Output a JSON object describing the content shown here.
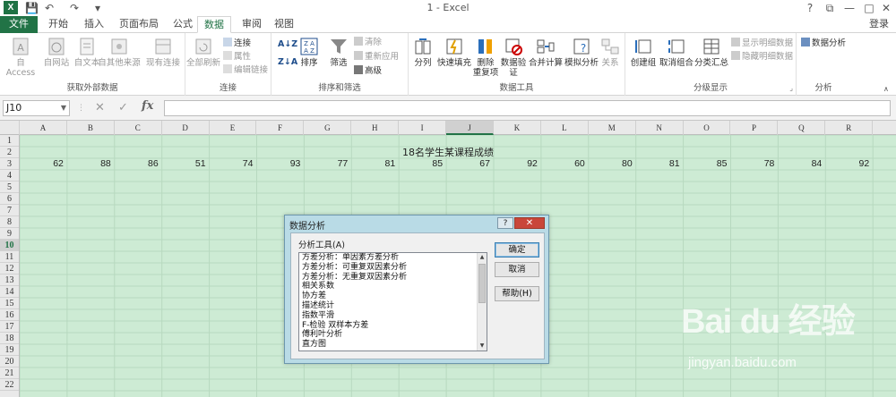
{
  "titlebar": {
    "title": "1 - Excel",
    "undo": "↶",
    "redo": "↷",
    "save": "💾",
    "qa_more": "▾",
    "app_icon": "X",
    "help": "?",
    "restore": "⧉",
    "min": "—",
    "max": "□",
    "close": "✕"
  },
  "tabs": [
    {
      "label": "文件"
    },
    {
      "label": "开始"
    },
    {
      "label": "插入"
    },
    {
      "label": "页面布局"
    },
    {
      "label": "公式"
    },
    {
      "label": "数据"
    },
    {
      "label": "审阅"
    },
    {
      "label": "视图"
    }
  ],
  "login": "登录",
  "ribbon": {
    "groups": {
      "external": "获取外部数据",
      "connections": "连接",
      "sort_filter": "排序和筛选",
      "data_tools": "数据工具",
      "outline": "分级显示",
      "analysis": "分析"
    },
    "buttons": {
      "from_access": "自 Access",
      "from_web": "自网站",
      "from_text": "自文本",
      "from_other": "自其他来源",
      "existing": "现有连接",
      "refresh_all": "全部刷新",
      "connections": "连接",
      "properties": "属性",
      "edit_links": "编辑链接",
      "sort_az": "A↓Z",
      "sort_za": "Z↓A",
      "sort": "排序",
      "filter": "筛选",
      "clear": "清除",
      "reapply": "重新应用",
      "advanced": "高级",
      "split": "分列",
      "flash_fill": "快速填充",
      "remove_dup_1": "删除",
      "remove_dup_2": "重复项",
      "validation_1": "数据验",
      "validation_2": "证",
      "consolidate": "合并计算",
      "what_if": "模拟分析",
      "relations": "关系",
      "group": "创建组",
      "ungroup": "取消组合",
      "subtotal": "分类汇总",
      "show_detail": "显示明细数据",
      "hide_detail": "隐藏明细数据",
      "data_analysis": "数据分析"
    }
  },
  "formula": {
    "namebox": "J10",
    "cancel": "✕",
    "enter": "✓",
    "fx": "fx",
    "value": ""
  },
  "columns": [
    "A",
    "B",
    "C",
    "D",
    "E",
    "F",
    "G",
    "H",
    "I",
    "J",
    "K",
    "L",
    "M",
    "N",
    "O",
    "P",
    "Q",
    "R"
  ],
  "rows": [
    "1",
    "2",
    "3",
    "4",
    "5",
    "6",
    "7",
    "8",
    "9",
    "10",
    "11",
    "12",
    "13",
    "14",
    "15",
    "16",
    "17",
    "18",
    "19",
    "20",
    "21",
    "22"
  ],
  "sheet": {
    "title": "18名学生某课程成绩",
    "scores": [
      "62",
      "88",
      "86",
      "51",
      "74",
      "93",
      "77",
      "81",
      "85",
      "67",
      "92",
      "60",
      "80",
      "81",
      "85",
      "78",
      "84",
      "92"
    ]
  },
  "dialog": {
    "title": "数据分析",
    "help": "?",
    "close": "✕",
    "label": "分析工具(A)",
    "items": [
      "方差分析：单因素方差分析",
      "方差分析：可重复双因素分析",
      "方差分析：无重复双因素分析",
      "相关系数",
      "协方差",
      "描述统计",
      "指数平滑",
      "F-检验 双样本方差",
      "傅利叶分析",
      "直方图"
    ],
    "ok": "确定",
    "cancel": "取消",
    "help_btn": "帮助(H)"
  },
  "watermark": {
    "brand": "Bai du 经验",
    "url": "jingyan.baidu.com"
  }
}
